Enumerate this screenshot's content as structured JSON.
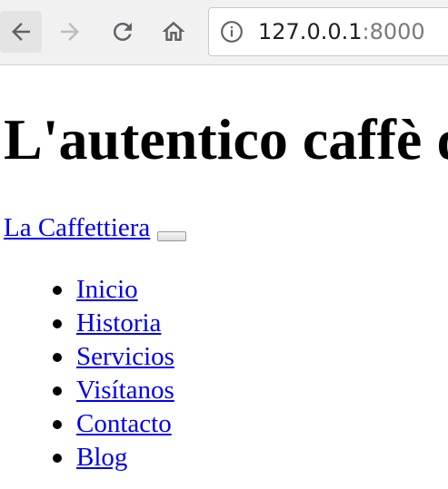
{
  "browser": {
    "url_host": "127.0.0.1",
    "url_port": ":8000"
  },
  "page": {
    "heading": "L'autentico caffè d",
    "brand": "La Caffettiera",
    "nav": [
      {
        "label": "Inicio"
      },
      {
        "label": "Historia"
      },
      {
        "label": "Servicios"
      },
      {
        "label": "Visítanos"
      },
      {
        "label": "Contacto"
      },
      {
        "label": "Blog"
      }
    ]
  },
  "icons": {
    "back": "back-arrow-icon",
    "forward": "forward-arrow-icon",
    "reload": "reload-icon",
    "home": "home-icon",
    "info": "info-icon",
    "bullet": "bullet-icon"
  },
  "colors": {
    "link": "#0000ee",
    "toolbar": "#f1f1f1",
    "icon": "#5f6368",
    "icon_disabled": "#bdbdbd"
  }
}
